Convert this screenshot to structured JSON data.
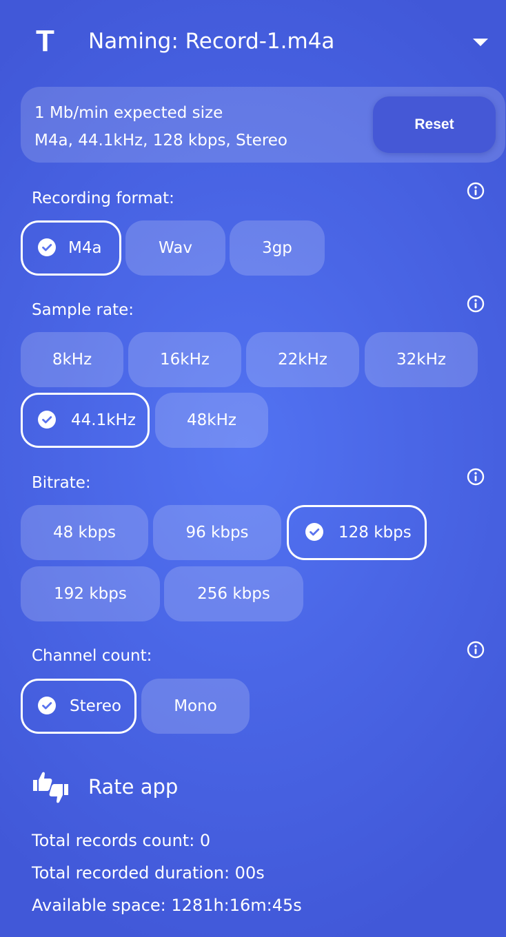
{
  "header": {
    "naming_icon_glyph": "T",
    "naming_label": "Naming: Record-1.m4a",
    "dropdown_icon": "caret-down-icon"
  },
  "info_card": {
    "size_text": "1 Mb/min expected size",
    "details_text": "M4a, 44.1kHz, 128 kbps, Stereo",
    "reset_label": "Reset"
  },
  "recording_format": {
    "label": "Recording format:",
    "options": [
      "M4a",
      "Wav",
      "3gp"
    ],
    "selected": "M4a"
  },
  "sample_rate": {
    "label": "Sample rate:",
    "options": [
      "8kHz",
      "16kHz",
      "22kHz",
      "32kHz",
      "44.1kHz",
      "48kHz"
    ],
    "selected": "44.1kHz"
  },
  "bitrate": {
    "label": "Bitrate:",
    "options": [
      "48 kbps",
      "96 kbps",
      "128 kbps",
      "192 kbps",
      "256 kbps"
    ],
    "selected": "128 kbps"
  },
  "channel_count": {
    "label": "Channel count:",
    "options": [
      "Stereo",
      "Mono"
    ],
    "selected": "Stereo"
  },
  "rate_app": {
    "label": "Rate app",
    "icon": "thumbs-up-down-icon"
  },
  "stats": {
    "records_count": "Total records count: 0",
    "recorded_duration": "Total recorded duration: 00s",
    "available_space": "Available space: 1281h:16m:45s"
  },
  "colors": {
    "background": "#4a66e6",
    "reset_button": "#4558d6",
    "text": "#ffffff"
  }
}
